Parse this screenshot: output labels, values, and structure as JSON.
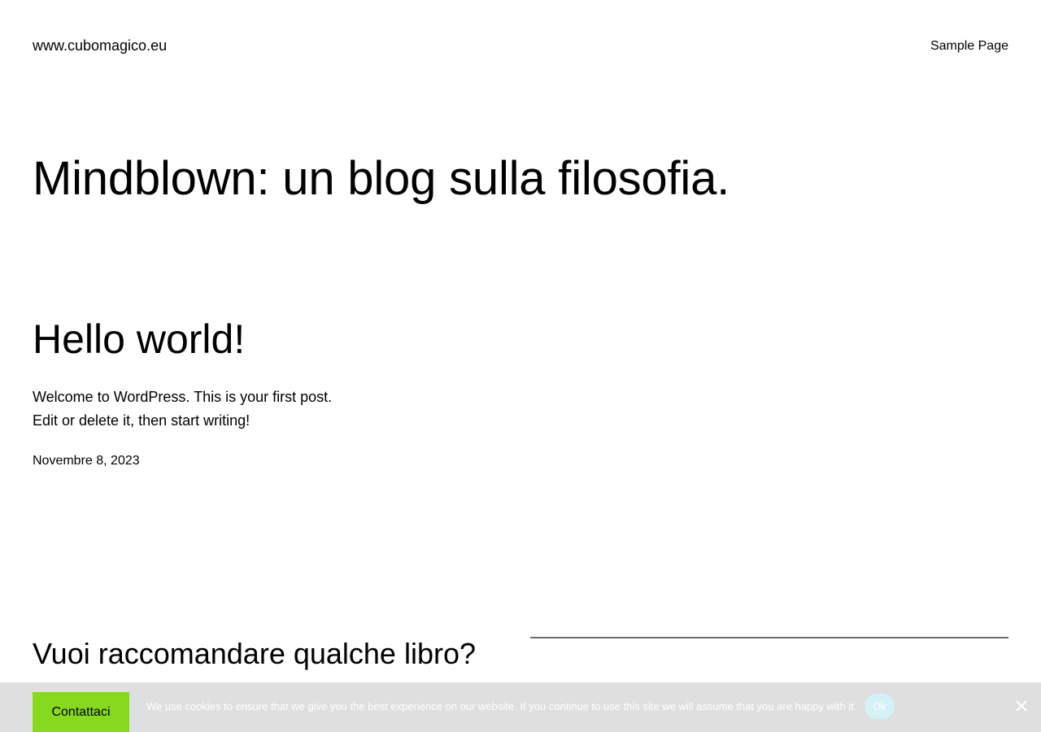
{
  "header": {
    "site_title": "www.cubomagico.eu",
    "nav": [
      {
        "label": "Sample Page"
      }
    ]
  },
  "hero": {
    "title": "Mindblown: un blog sulla filosofia."
  },
  "post": {
    "title": "Hello world!",
    "excerpt_line1": "Welcome to WordPress. This is your first post.",
    "excerpt_line2": "Edit or delete it, then start writing!",
    "date": "Novembre 8, 2023"
  },
  "section": {
    "title": "Vuoi raccomandare qualche libro?"
  },
  "cookie_notice": {
    "text": "We use cookies to ensure that we give you the best experience on our website. If you continue to use this site we will assume that you are happy with it.",
    "ok_label": "Ok",
    "close_icon": "close-icon"
  },
  "contact_button": {
    "label": "Contattaci"
  },
  "colors": {
    "contact_button_bg": "#86d91e",
    "cookie_bar_bg": "#dcdcdc",
    "ok_button_bg": "#d4f1f7",
    "divider": "#6b6b6b"
  }
}
